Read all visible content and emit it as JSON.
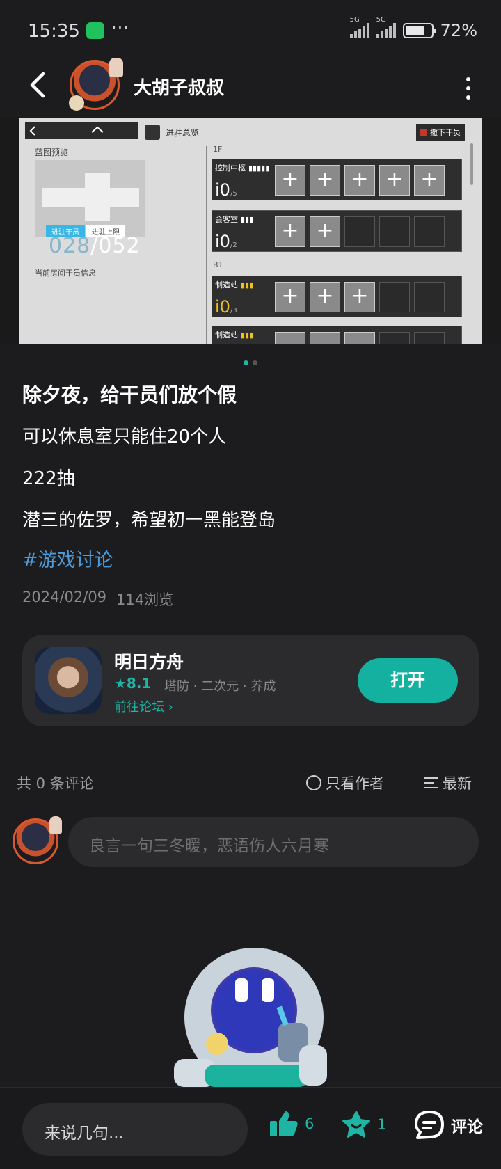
{
  "status": {
    "time": "15:35",
    "dots": "···",
    "net1": "5G",
    "net2": "5G",
    "battery_pct": "72%",
    "battery_level": 0.72
  },
  "header": {
    "author_name": "大胡子叔叔"
  },
  "screenshot": {
    "overview_label": "进驻总览",
    "withdraw_label": "撤下干员",
    "preview_label": "蓝图预览",
    "tab_stationed": "进驻干员",
    "tab_limit": "进驻上限",
    "count_current": "028",
    "count_max": "/052",
    "room_info": "当前房间干员信息",
    "floor_1f": "1F",
    "floor_b1": "B1",
    "rooms": [
      {
        "name": "控制中枢",
        "count": "0",
        "cap": "/5"
      },
      {
        "name": "会客室",
        "count": "0",
        "cap": "/2"
      },
      {
        "name": "制造站",
        "count": "0",
        "cap": "/3"
      },
      {
        "name": "制造站",
        "count": "",
        "cap": ""
      }
    ],
    "plus": "+"
  },
  "post": {
    "title": "除夕夜，给干员们放个假",
    "lines": [
      "可以休息室只能住20个人",
      "222抽",
      "潜三的佐罗，希望初一黑能登岛"
    ],
    "tag": "#游戏讨论",
    "date": "2024/02/09",
    "views": "114浏览"
  },
  "game": {
    "name": "明日方舟",
    "rating": "★8.1",
    "tags": "塔防 · 二次元 · 养成",
    "forum_link": "前往论坛 ›",
    "open_label": "打开"
  },
  "comments": {
    "count_label": "共 0 条评论",
    "author_only_label": "只看作者",
    "sort_label": "最新",
    "input_placeholder": "良言一句三冬暖，恶语伤人六月寒"
  },
  "bottom": {
    "say_placeholder": "来说几句...",
    "like_count": "6",
    "fav_count": "1",
    "comment_label": "评论"
  },
  "colors": {
    "accent": "#1fb5a5",
    "tag_blue": "#4e9bd8",
    "background": "#1c1c1e"
  }
}
